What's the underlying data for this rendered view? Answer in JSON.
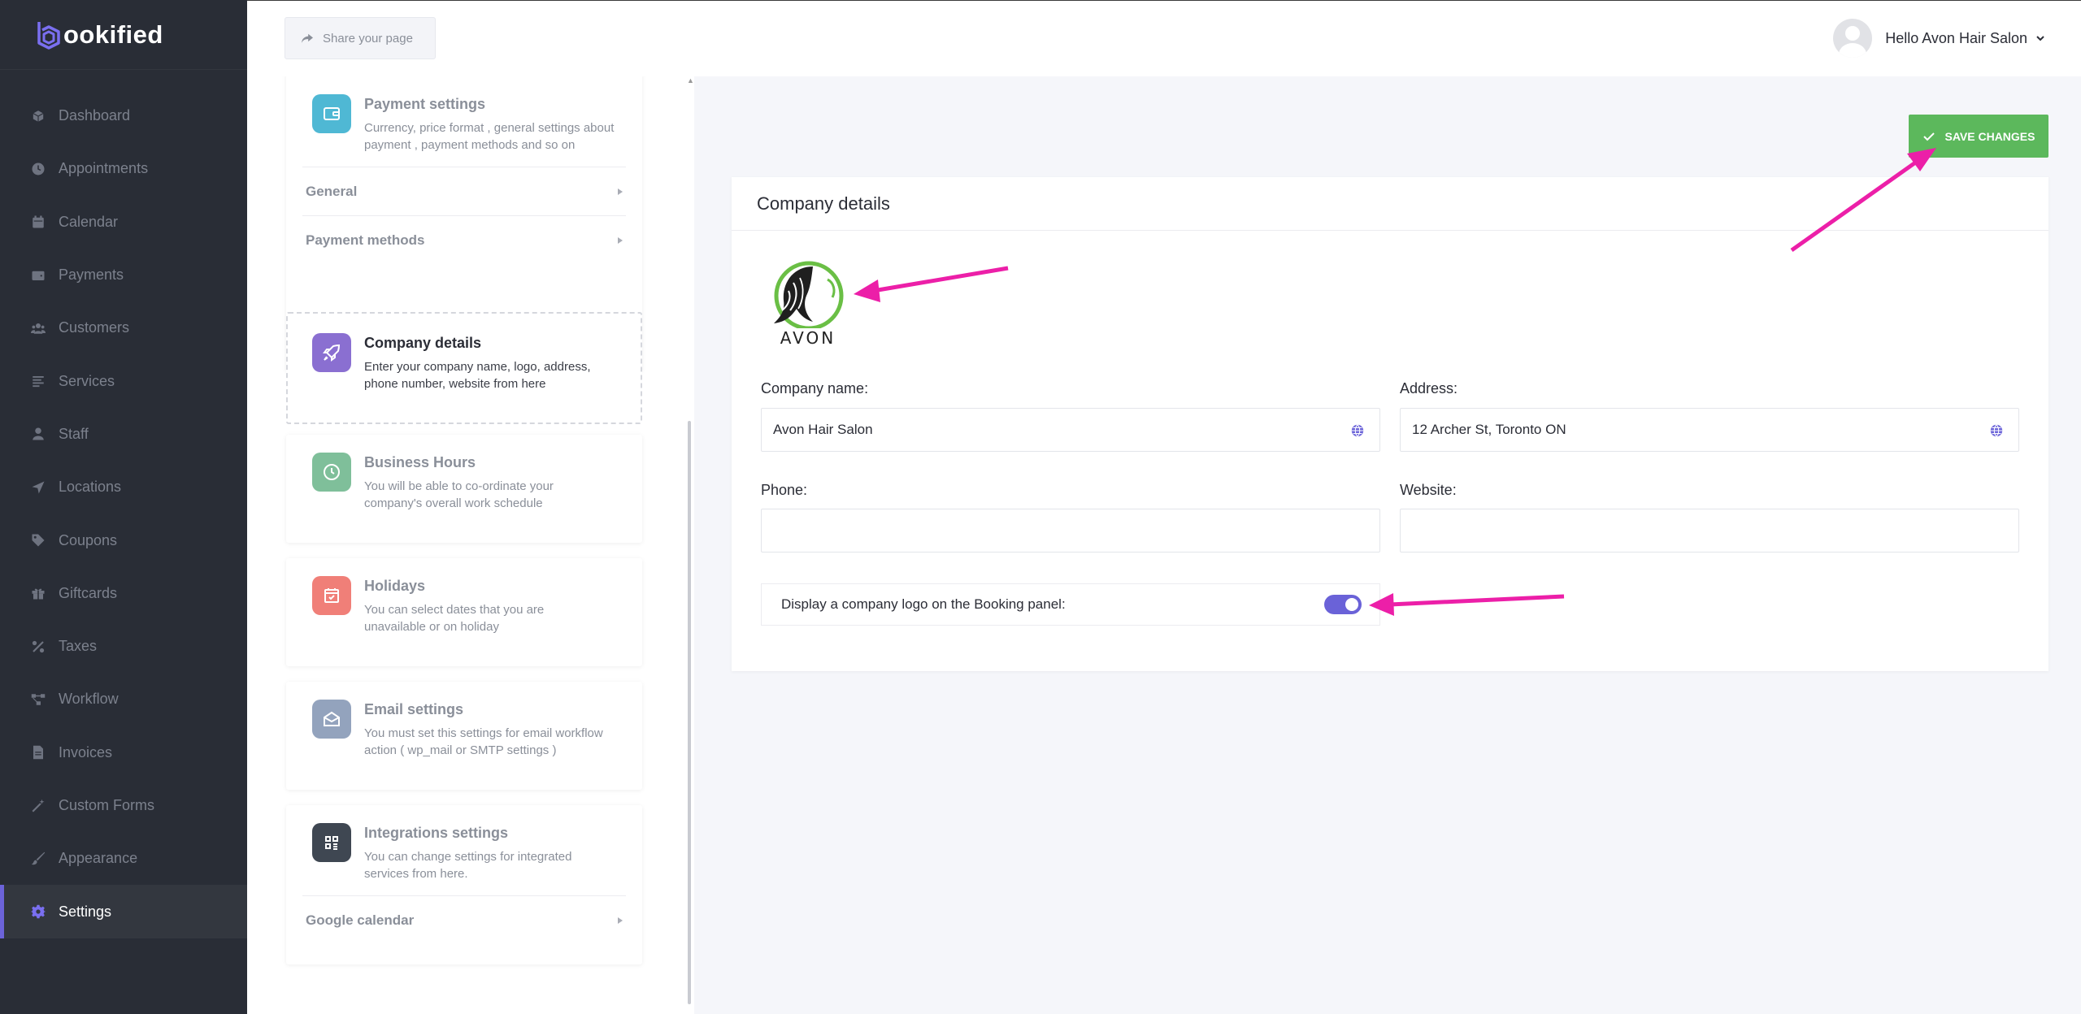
{
  "brand": {
    "letter": "b",
    "rest": "ookified"
  },
  "nav": [
    {
      "label": "Dashboard",
      "icon": "cube-icon",
      "active": false
    },
    {
      "label": "Appointments",
      "icon": "clock-icon",
      "active": false
    },
    {
      "label": "Calendar",
      "icon": "calendar-icon",
      "active": false
    },
    {
      "label": "Payments",
      "icon": "wallet-icon",
      "active": false
    },
    {
      "label": "Customers",
      "icon": "users-icon",
      "active": false
    },
    {
      "label": "Services",
      "icon": "list-icon",
      "active": false
    },
    {
      "label": "Staff",
      "icon": "user-icon",
      "active": false
    },
    {
      "label": "Locations",
      "icon": "location-arrow-icon",
      "active": false
    },
    {
      "label": "Coupons",
      "icon": "tag-icon",
      "active": false
    },
    {
      "label": "Giftcards",
      "icon": "gift-icon",
      "active": false
    },
    {
      "label": "Taxes",
      "icon": "percent-icon",
      "active": false
    },
    {
      "label": "Workflow",
      "icon": "workflow-icon",
      "active": false
    },
    {
      "label": "Invoices",
      "icon": "file-icon",
      "active": false
    },
    {
      "label": "Custom Forms",
      "icon": "magic-wand-icon",
      "active": false
    },
    {
      "label": "Appearance",
      "icon": "brush-icon",
      "active": false
    },
    {
      "label": "Settings",
      "icon": "gear-icon",
      "active": true
    }
  ],
  "topbar": {
    "share_label": "Share your page",
    "greeting": "Hello Avon Hair Salon"
  },
  "settings_cards": {
    "payment": {
      "title": "Payment settings",
      "desc": "Currency, price format , general settings about payment , payment methods and so on",
      "sub": [
        "General",
        "Payment methods"
      ],
      "color": "#4fb8d4"
    },
    "company": {
      "title": "Company details",
      "desc": "Enter your company name, logo, address, phone number, website from here",
      "color": "#8a6fd1"
    },
    "hours": {
      "title": "Business Hours",
      "desc": "You will be able to co-ordinate your company's overall work schedule",
      "color": "#7fbf9a"
    },
    "holidays": {
      "title": "Holidays",
      "desc": "You can select dates that you are unavailable or on holiday",
      "color": "#f07f78"
    },
    "email": {
      "title": "Email settings",
      "desc": "You must set this settings for email workflow action ( wp_mail or SMTP settings )",
      "color": "#93a3bd"
    },
    "integrations": {
      "title": "Integrations settings",
      "desc": "You can change settings for integrated services from here.",
      "sub": [
        "Google calendar"
      ],
      "color": "#3f4752"
    }
  },
  "main": {
    "save_label": "SAVE CHANGES",
    "section_title": "Company details",
    "logo_text": "AVON",
    "company_name_label": "Company name:",
    "company_name_value": "Avon Hair Salon",
    "address_label": "Address:",
    "address_value": "12 Archer St, Toronto ON",
    "phone_label": "Phone:",
    "phone_value": "",
    "website_label": "Website:",
    "website_value": "",
    "toggle_label": "Display a company logo on the Booking panel:",
    "toggle_on": true
  },
  "colors": {
    "accent": "#6a62d8",
    "save_green": "#5cb85c",
    "annotation_arrow": "#ec1fa8",
    "sidebar_bg": "#292d36"
  }
}
